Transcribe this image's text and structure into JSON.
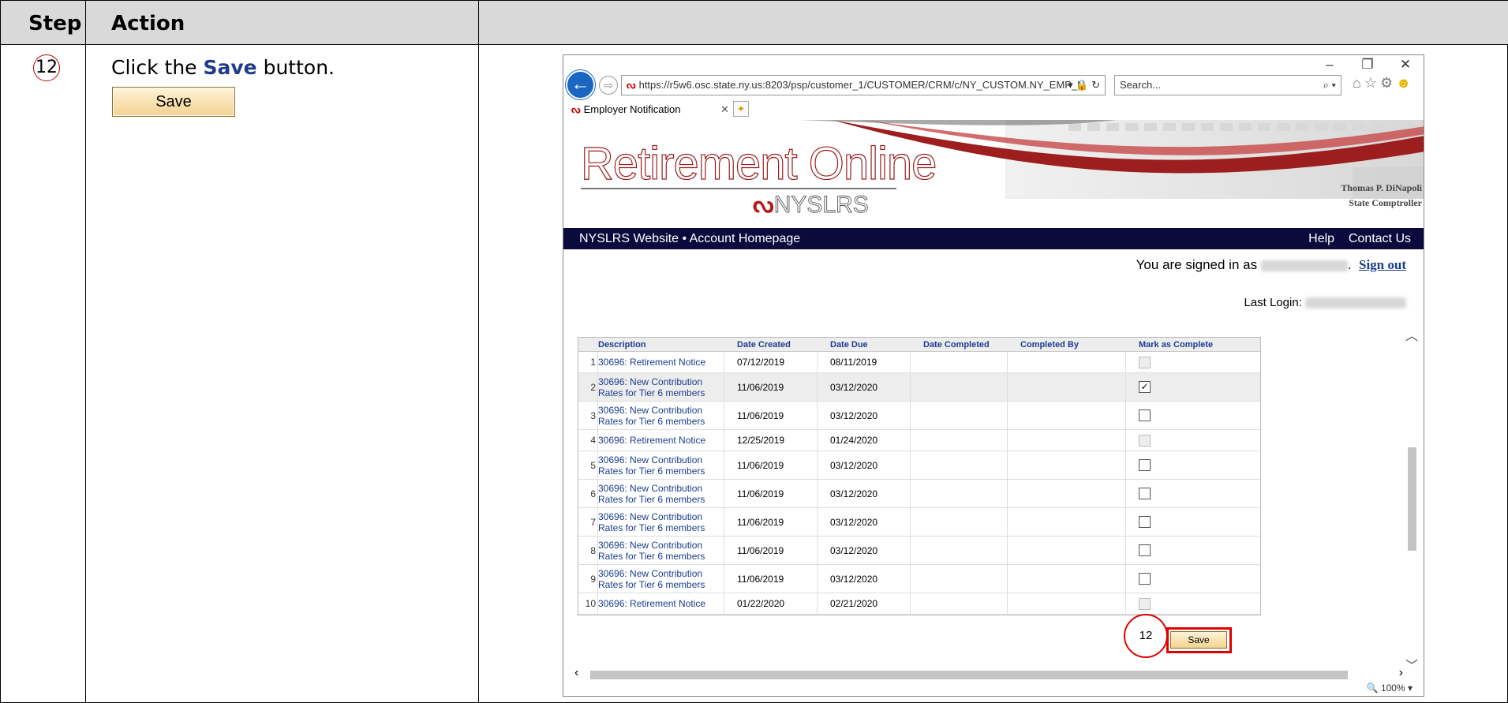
{
  "doc": {
    "header_step": "Step",
    "header_action": "Action",
    "step_number": "12",
    "instruction_prefix": "Click the ",
    "instruction_bold": "Save",
    "instruction_suffix": " button.",
    "save_button_label": "Save"
  },
  "browser": {
    "window_controls": [
      "–",
      "❐",
      "✕"
    ],
    "url": "https://r5w6.osc.state.ny.us:8203/psp/customer_1/CUSTOMER/CRM/c/NY_CUSTOM.NY_EMP_N",
    "url_suffix_icons": "▾ 🔒 ↻",
    "search_placeholder": "Search...",
    "tab_title": "Employer Notification",
    "zoom": "🔍 100%  ▾"
  },
  "banner": {
    "logo_title": "Retirement Online",
    "logo_subtitle": "NYSLRS",
    "official_name": "Thomas P. DiNapoli",
    "official_title": "State Comptroller"
  },
  "nav": {
    "website": "NYSLRS Website",
    "separator": "•",
    "homepage": "Account Homepage",
    "help": "Help",
    "contact": "Contact Us"
  },
  "account": {
    "signed_in_prefix": "You are signed in as",
    "sign_out": "Sign out",
    "last_login_label": "Last Login:"
  },
  "grid": {
    "columns": [
      "Description",
      "Date Created",
      "Date Due",
      "Date Completed",
      "Completed By",
      "Mark as Complete"
    ],
    "rows": [
      {
        "num": "1",
        "description": "30696: Retirement Notice",
        "created": "07/12/2019",
        "due": "08/11/2019",
        "checked": false,
        "disabled": true
      },
      {
        "num": "2",
        "description": "30696: New Contribution Rates for Tier 6 members",
        "created": "11/06/2019",
        "due": "03/12/2020",
        "checked": true,
        "disabled": false
      },
      {
        "num": "3",
        "description": "30696: New Contribution Rates for Tier 6 members",
        "created": "11/06/2019",
        "due": "03/12/2020",
        "checked": false,
        "disabled": false
      },
      {
        "num": "4",
        "description": "30696: Retirement Notice",
        "created": "12/25/2019",
        "due": "01/24/2020",
        "checked": false,
        "disabled": true
      },
      {
        "num": "5",
        "description": "30696: New Contribution Rates for Tier 6 members",
        "created": "11/06/2019",
        "due": "03/12/2020",
        "checked": false,
        "disabled": false
      },
      {
        "num": "6",
        "description": "30696: New Contribution Rates for Tier 6 members",
        "created": "11/06/2019",
        "due": "03/12/2020",
        "checked": false,
        "disabled": false
      },
      {
        "num": "7",
        "description": "30696: New Contribution Rates for Tier 6 members",
        "created": "11/06/2019",
        "due": "03/12/2020",
        "checked": false,
        "disabled": false
      },
      {
        "num": "8",
        "description": "30696: New Contribution Rates for Tier 6 members",
        "created": "11/06/2019",
        "due": "03/12/2020",
        "checked": false,
        "disabled": false
      },
      {
        "num": "9",
        "description": "30696: New Contribution Rates for Tier 6 members",
        "created": "11/06/2019",
        "due": "03/12/2020",
        "checked": false,
        "disabled": false
      },
      {
        "num": "10",
        "description": "30696: Retirement Notice",
        "created": "01/22/2020",
        "due": "02/21/2020",
        "checked": false,
        "disabled": true
      }
    ],
    "save_label": "Save",
    "callout_number": "12"
  }
}
